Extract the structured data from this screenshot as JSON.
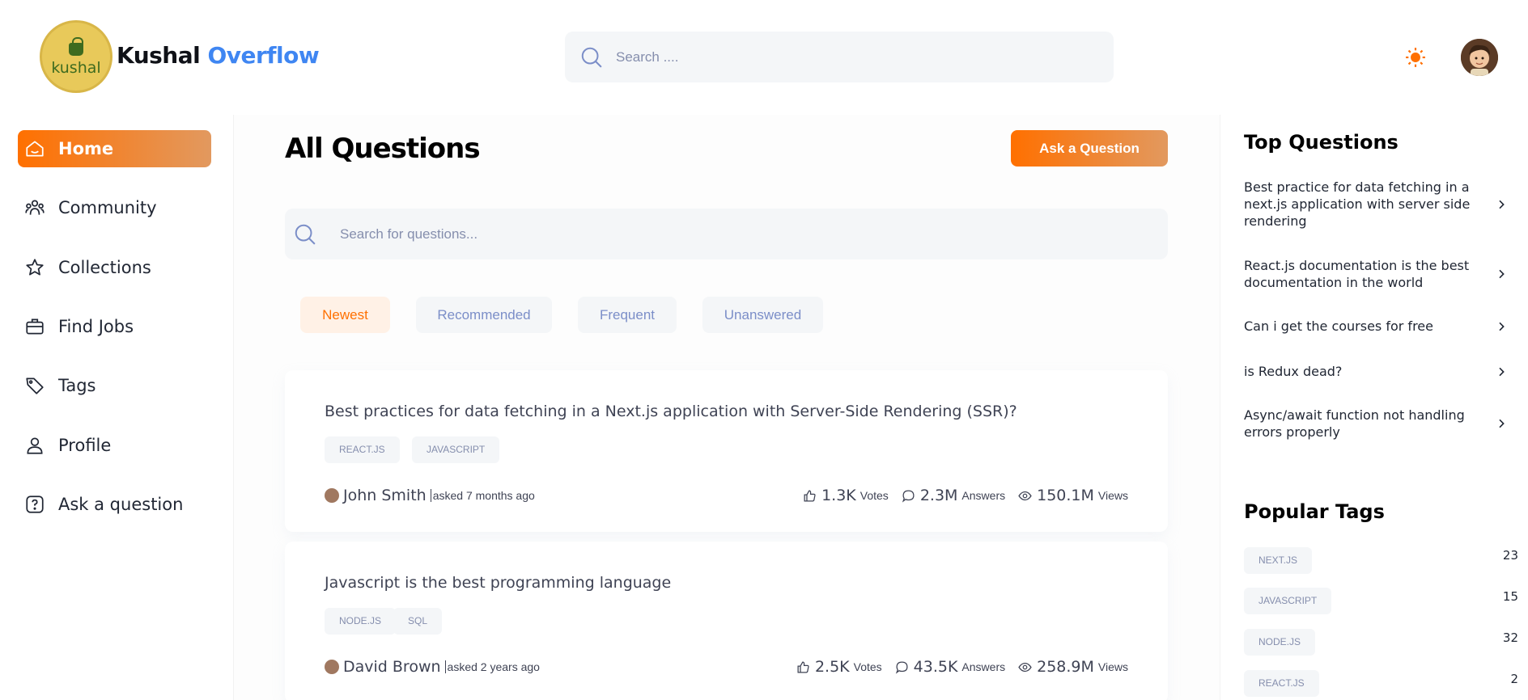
{
  "brand": {
    "logo_text": "kushal",
    "name_part1": "Kushal",
    "name_part2": "Overflow",
    "accent": "#ff7000",
    "blue": "#3f86f2"
  },
  "global_search": {
    "placeholder": "Search ...."
  },
  "header_icons": {
    "theme": "sun-icon",
    "avatar": "user-avatar"
  },
  "sidebar": {
    "items": [
      {
        "label": "Home",
        "icon": "home-icon",
        "active": true
      },
      {
        "label": "Community",
        "icon": "users-icon"
      },
      {
        "label": "Collections",
        "icon": "star-icon"
      },
      {
        "label": "Find Jobs",
        "icon": "briefcase-icon"
      },
      {
        "label": "Tags",
        "icon": "tag-icon"
      },
      {
        "label": "Profile",
        "icon": "user-icon"
      },
      {
        "label": "Ask a question",
        "icon": "question-icon"
      }
    ]
  },
  "main": {
    "title": "All Questions",
    "ask_button": "Ask a Question",
    "search_placeholder": "Search for questions...",
    "filters": [
      "Newest",
      "Recommended",
      "Frequent",
      "Unanswered"
    ],
    "questions": [
      {
        "title": "Best practices for data fetching in a Next.js application with Server-Side Rendering (SSR)?",
        "tags": [
          "REACT.JS",
          "JAVASCRIPT"
        ],
        "author": "John Smith",
        "asked": "asked 7 months ago",
        "votes": "1.3K",
        "votes_label": "Votes",
        "answers": "2.3M",
        "answers_label": "Answers",
        "views": "150.1M",
        "views_label": "Views"
      },
      {
        "title": "Javascript is the best programming language",
        "tags": [
          "NODE.JS",
          "SQL"
        ],
        "author": "David Brown",
        "asked": "asked 2 years ago",
        "votes": "2.5K",
        "votes_label": "Votes",
        "answers": "43.5K",
        "answers_label": "Answers",
        "views": "258.9M",
        "views_label": "Views"
      }
    ]
  },
  "right_sidebar": {
    "top_questions_title": "Top Questions",
    "top_questions": [
      "Best practice for data fetching in a next.js application with server side rendering",
      "React.js documentation is the best documentation in the world",
      "Can i get the courses for free",
      "is Redux dead?",
      "Async/await function not handling errors properly"
    ],
    "popular_tags_title": "Popular Tags",
    "popular_tags": [
      {
        "name": "NEXT.JS",
        "count": "23"
      },
      {
        "name": "JAVASCRIPT",
        "count": "15"
      },
      {
        "name": "NODE.JS",
        "count": "32"
      },
      {
        "name": "REACT.JS",
        "count": "2"
      }
    ]
  }
}
